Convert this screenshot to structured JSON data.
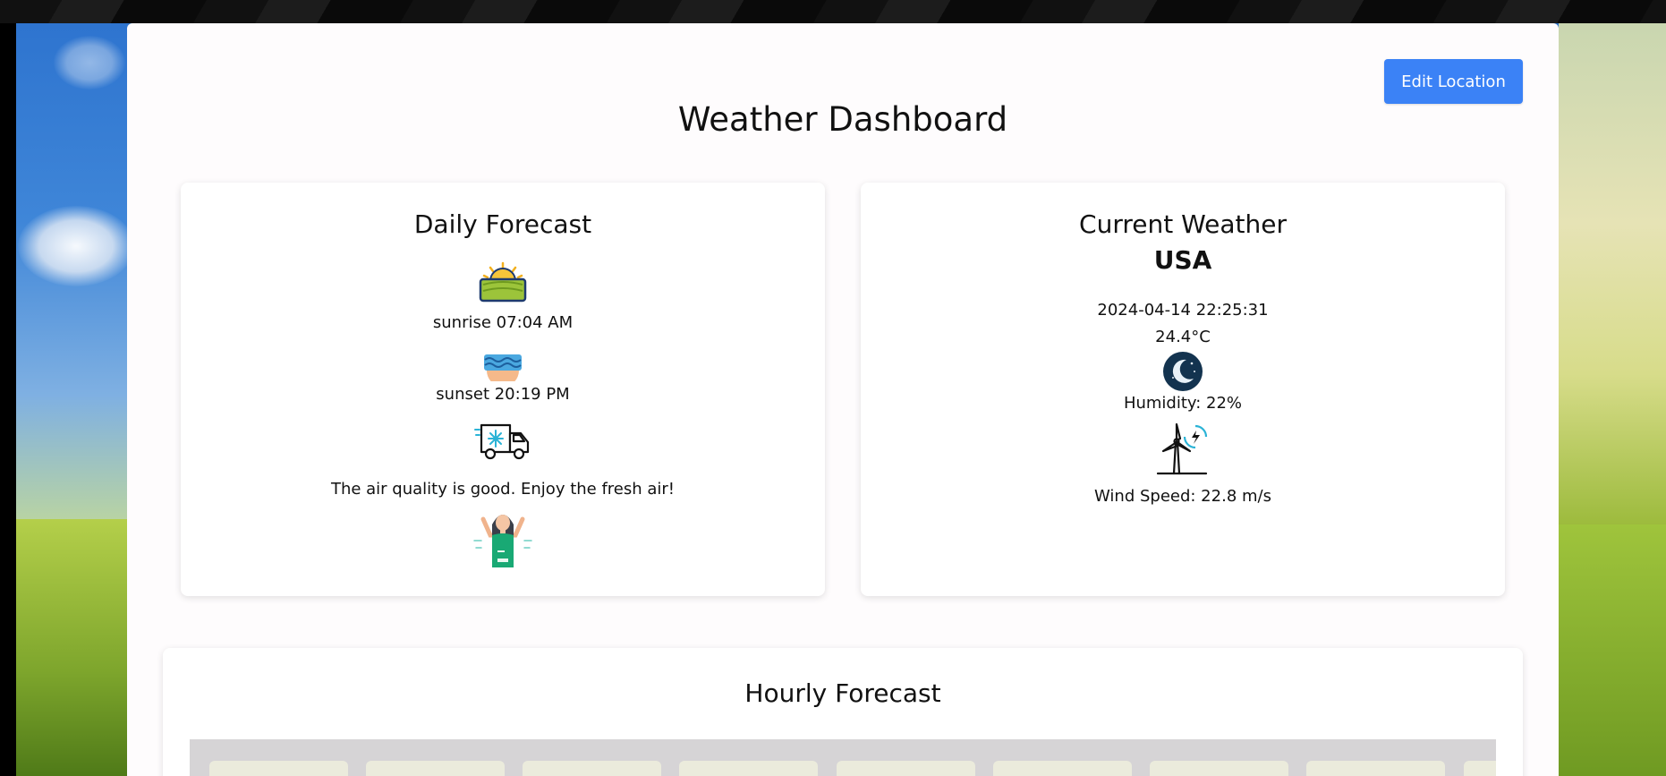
{
  "header": {
    "title": "Weather Dashboard",
    "edit_location_label": "Edit Location"
  },
  "daily": {
    "title": "Daily Forecast",
    "sunrise_text": "sunrise 07:04 AM",
    "sunset_text": "sunset 20:19 PM",
    "air_quality_text": "The air quality is good. Enjoy the fresh air!",
    "icons": [
      "sunrise-icon",
      "sunset-icon",
      "air-quality-truck-icon",
      "happy-person-icon"
    ]
  },
  "current": {
    "title": "Current Weather",
    "country": "USA",
    "datetime": "2024-04-14 22:25:31",
    "temperature": "24.4°C",
    "humidity_text": "Humidity: 22%",
    "wind_text": "Wind Speed: 22.8 m/s",
    "icons": [
      "night-moon-icon",
      "wind-turbine-icon"
    ]
  },
  "hourly": {
    "title": "Hourly Forecast"
  },
  "colors": {
    "accent": "#3b82f6",
    "panel": "#fefcfd",
    "hourly_strip": "#d6d4d6",
    "hour_tile": "#ebebdc"
  }
}
